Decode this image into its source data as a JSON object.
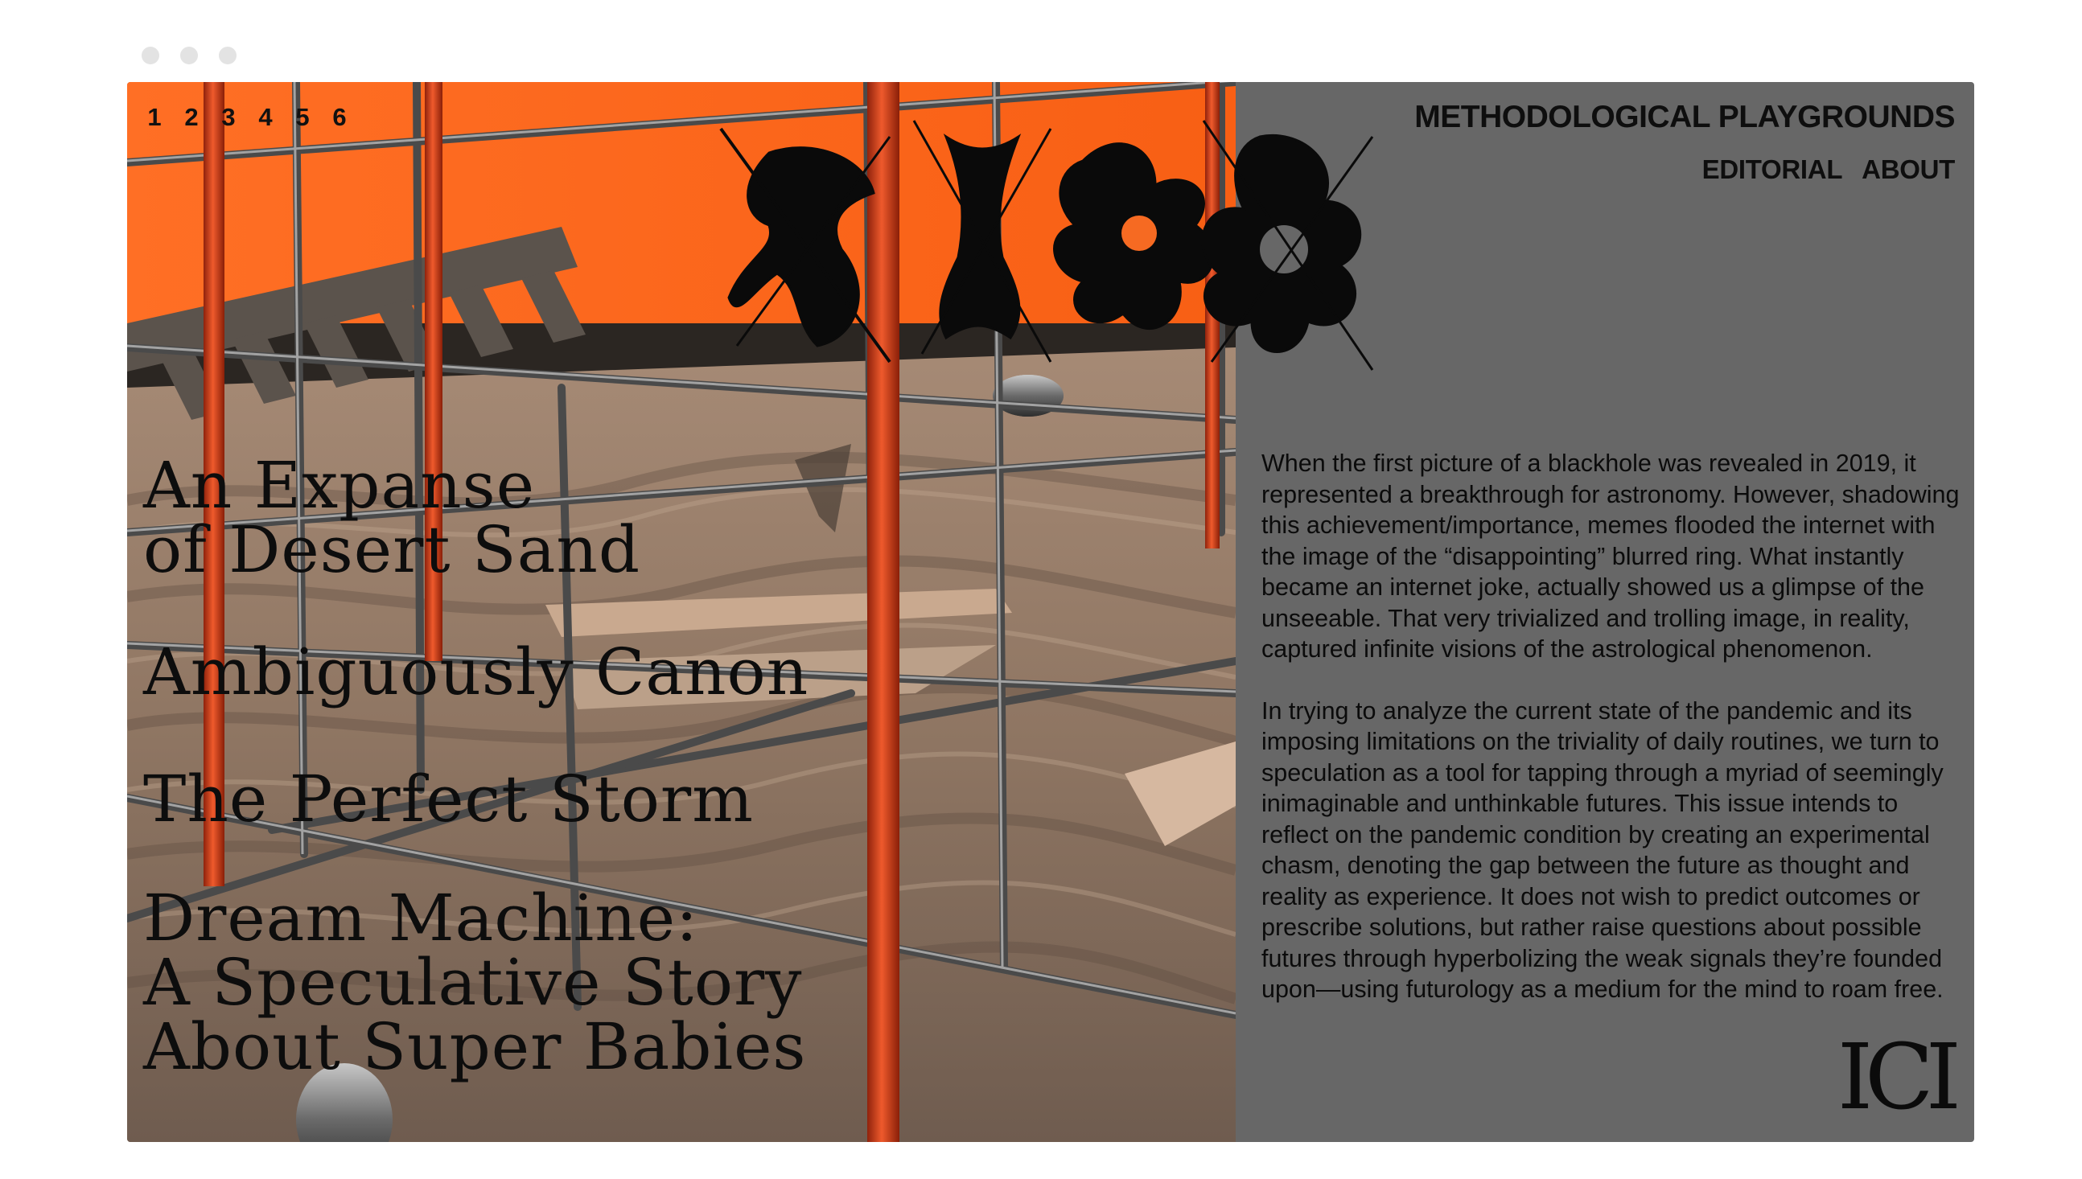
{
  "issues": [
    "1",
    "2",
    "3",
    "4",
    "5",
    "6"
  ],
  "site": {
    "title": "METHODOLOGICAL PLAYGROUNDS",
    "nav": [
      "EDITORIAL",
      "ABOUT"
    ]
  },
  "articles": [
    {
      "lines": [
        "An Expanse",
        "of Desert Sand"
      ]
    },
    {
      "lines": [
        "Ambiguously Canon"
      ]
    },
    {
      "lines": [
        "The Perfect Storm"
      ]
    },
    {
      "lines": [
        "Dream Machine:",
        "A Speculative Story",
        "About Super Babies"
      ]
    }
  ],
  "intro": [
    "When the first picture of a blackhole was revealed in 2019, it represented a breakthrough for astronomy. However, shadowing this achievement/importance, memes flooded the internet with the image of the “disappointing” blurred ring. What instantly became an internet joke, actually showed us a glimpse of the unseeable. That very trivialized and trolling image, in reality, captured infinite visions of the astrological phenomenon.",
    "In trying to analyze the current state of the pandemic and its imposing limitations on the triviality of daily routines, we turn to speculation as a tool for tapping through a myriad of seemingly inimaginable and unthinkable futures. This issue intends to reflect on the pandemic condition by creating an experimental chasm, denoting the gap between the future as thought and reality as experience. It does not wish to predict outcomes or prescribe solutions, but rather raise questions about possible futures through hyperbolizing the weak signals they’re founded upon—using futurology as a medium for the mind to roam free."
  ],
  "corner_mark": "ICI",
  "colors": {
    "wall": "#ff6a20",
    "panel": "#676767",
    "sand": "#8c7565",
    "poles": "#d8461c",
    "text": "#0e0e0e"
  },
  "icons": [
    "logo-glyph-icon"
  ]
}
